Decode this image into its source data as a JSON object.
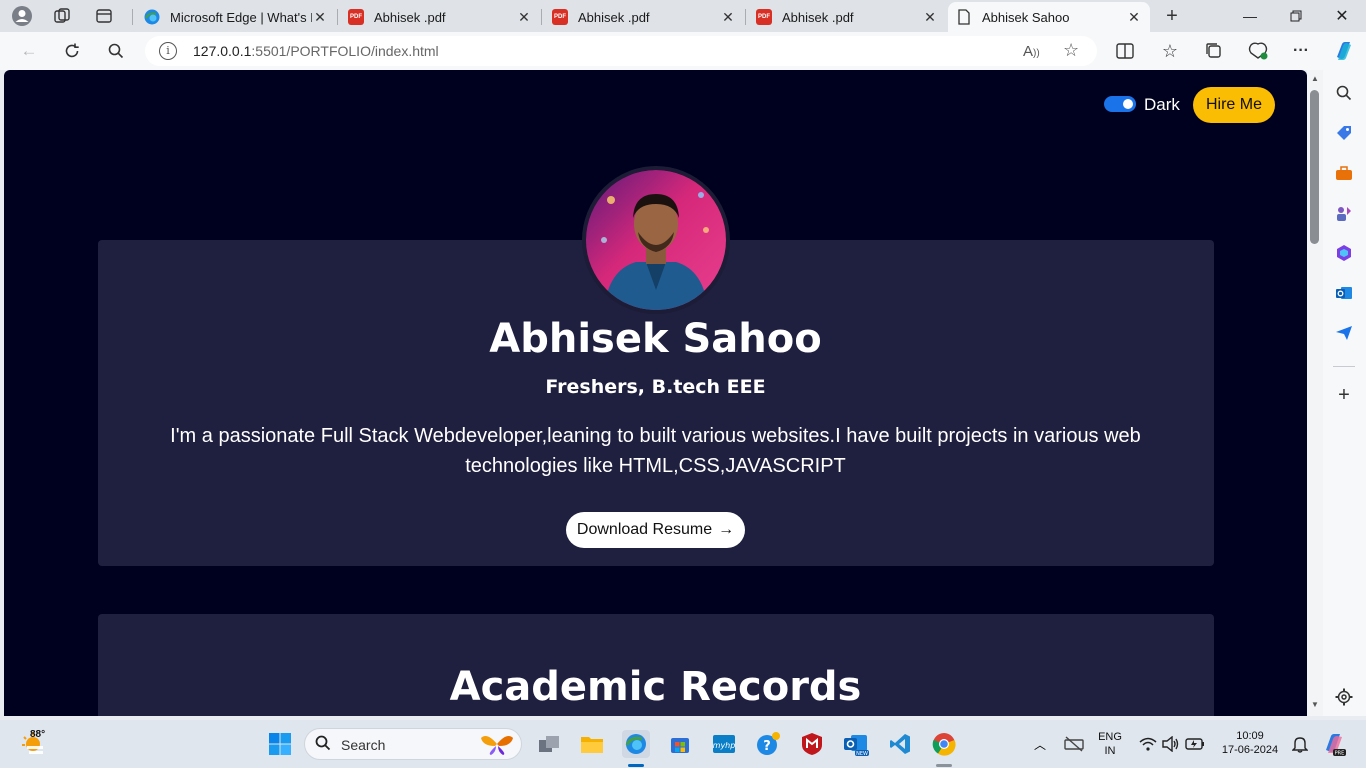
{
  "browser": {
    "tabs": [
      {
        "title": "Microsoft Edge | What's N",
        "close": "✕"
      },
      {
        "title": "Abhisek .pdf",
        "close": "✕"
      },
      {
        "title": "Abhisek .pdf",
        "close": "✕"
      },
      {
        "title": "Abhisek .pdf",
        "close": "✕"
      },
      {
        "title": "Abhisek Sahoo",
        "close": "✕"
      }
    ],
    "url_host": "127.0.0.1",
    "url_rest": ":5501/PORTFOLIO/index.html"
  },
  "page": {
    "theme_toggle_label": "Dark",
    "hire_button": "Hire Me",
    "name": "Abhisek Sahoo",
    "subtitle": "Freshers, B.tech EEE",
    "description": "I'm a passionate Full Stack Webdeveloper,leaning to built various websites.I have built projects in various web technologies like HTML,CSS,JAVASCRIPT",
    "download_button": "Download Resume",
    "download_arrow": "→",
    "academic_title": "Academic Records"
  },
  "taskbar": {
    "weather_temp": "88°",
    "search_placeholder": "Search",
    "lang_line1": "ENG",
    "lang_line2": "IN",
    "time": "10:09",
    "date": "17-06-2024"
  },
  "colors": {
    "page_bg": "#00001f",
    "card_bg": "#1f1f3f",
    "hire_button_bg": "#fbbc04",
    "toggle_on": "#1a73e8"
  }
}
